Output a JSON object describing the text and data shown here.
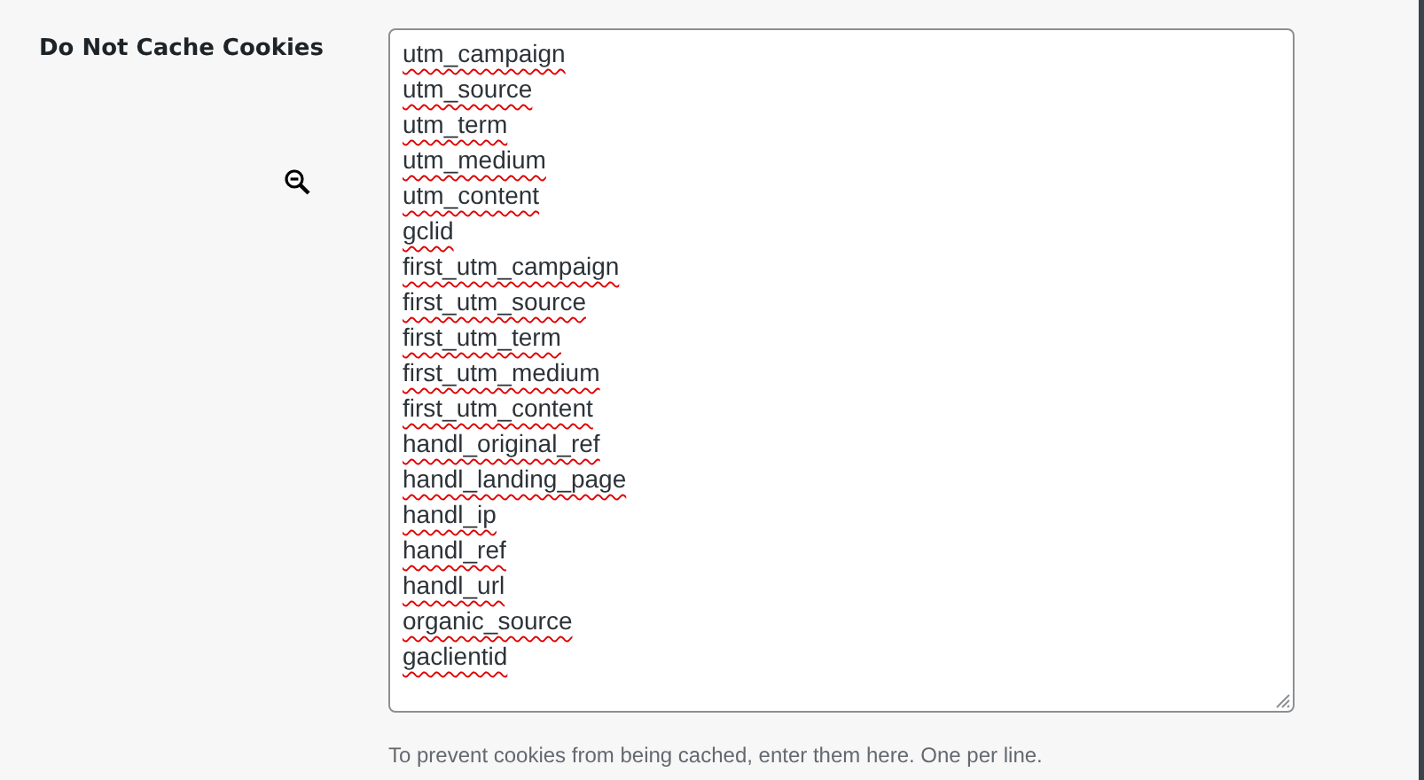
{
  "setting": {
    "label": "Do Not Cache Cookies",
    "lines": [
      {
        "text": "utm_campaign",
        "misspelled": true
      },
      {
        "text": "utm_source",
        "misspelled": true
      },
      {
        "text": "utm_term",
        "misspelled": true
      },
      {
        "text": "utm_medium",
        "misspelled": true
      },
      {
        "text": "utm_content",
        "misspelled": true
      },
      {
        "text": "gclid",
        "misspelled": true
      },
      {
        "text": "first_utm_campaign",
        "misspelled": true
      },
      {
        "text": "first_utm_source",
        "misspelled": true
      },
      {
        "text": "first_utm_term",
        "misspelled": true
      },
      {
        "text": "first_utm_medium",
        "misspelled": true
      },
      {
        "text": "first_utm_content",
        "misspelled": true
      },
      {
        "text": "handl_original_ref",
        "misspelled": true
      },
      {
        "text": "handl_landing_page",
        "misspelled": true
      },
      {
        "text": "handl_ip",
        "misspelled": true
      },
      {
        "text": "handl_ref",
        "misspelled": true
      },
      {
        "text": "handl_url",
        "misspelled": true
      },
      {
        "text": "organic_source",
        "misspelled": true
      },
      {
        "text": "gaclientid",
        "misspelled": true
      }
    ],
    "description": "To prevent cookies from being cached, enter them here. One per line."
  }
}
